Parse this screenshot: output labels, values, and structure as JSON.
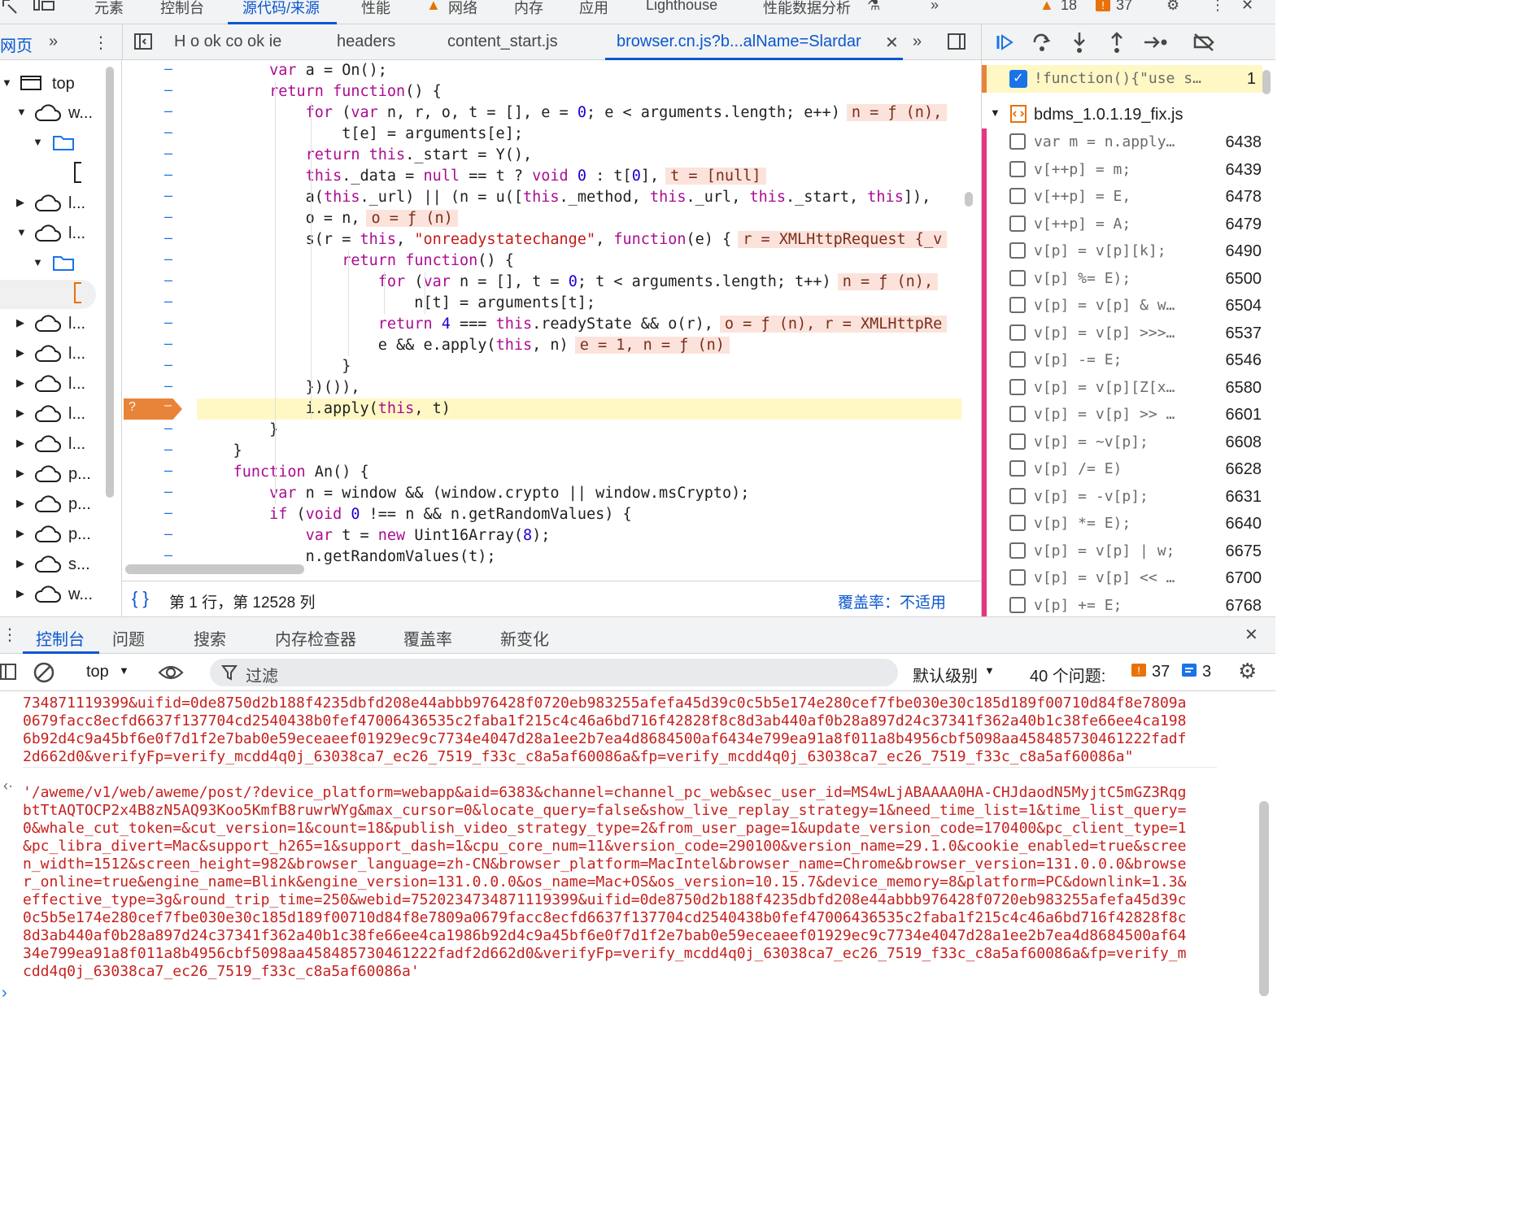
{
  "top_tabs": [
    "元素",
    "控制台",
    "源代码/来源",
    "性能",
    "网络",
    "内存",
    "应用",
    "Lighthouse",
    "性能数据分析"
  ],
  "top_counts": {
    "warnings": "18",
    "errors": "37"
  },
  "sub_tabs": {
    "page": "网页",
    "files": [
      "H o ok co ok ie",
      "headers",
      "content_start.js",
      "browser.cn.js?b...alName=Slardar"
    ]
  },
  "nav_tree": [
    "top",
    "w...",
    "l...",
    "l...",
    "l...",
    "l...",
    "l...",
    "l...",
    "l...",
    "p...",
    "p...",
    "p...",
    "s...",
    "w..."
  ],
  "code_lines": [
    [
      {
        "t": "        "
      },
      {
        "t": "var",
        "c": "kw"
      },
      {
        "t": " a = On();"
      }
    ],
    [
      {
        "t": "        "
      },
      {
        "t": "return",
        "c": "kw"
      },
      {
        "t": " "
      },
      {
        "t": "function",
        "c": "kw"
      },
      {
        "t": "() {"
      }
    ],
    [
      {
        "t": "            "
      },
      {
        "t": "for",
        "c": "kw"
      },
      {
        "t": " ("
      },
      {
        "t": "var",
        "c": "kw"
      },
      {
        "t": " n, r, o, t = [], e = "
      },
      {
        "t": "0",
        "c": "num"
      },
      {
        "t": "; e < arguments.length; e++)"
      },
      {
        "t": "n = ƒ (n),",
        "c": "inl"
      }
    ],
    [
      {
        "t": "                t[e] = arguments[e];"
      }
    ],
    [
      {
        "t": "            "
      },
      {
        "t": "return",
        "c": "kw"
      },
      {
        "t": " "
      },
      {
        "t": "this",
        "c": "kw"
      },
      {
        "t": "._start = Y(),"
      }
    ],
    [
      {
        "t": "            "
      },
      {
        "t": "this",
        "c": "kw"
      },
      {
        "t": "._data = "
      },
      {
        "t": "null",
        "c": "kw"
      },
      {
        "t": " == t ? "
      },
      {
        "t": "void",
        "c": "kw"
      },
      {
        "t": " "
      },
      {
        "t": "0",
        "c": "num"
      },
      {
        "t": " : t["
      },
      {
        "t": "0",
        "c": "num"
      },
      {
        "t": "],"
      },
      {
        "t": "t = [null]",
        "c": "inl"
      }
    ],
    [
      {
        "t": "            a("
      },
      {
        "t": "this",
        "c": "kw"
      },
      {
        "t": "._url) || (n = u(["
      },
      {
        "t": "this",
        "c": "kw"
      },
      {
        "t": "._method, "
      },
      {
        "t": "this",
        "c": "kw"
      },
      {
        "t": "._url, "
      },
      {
        "t": "this",
        "c": "kw"
      },
      {
        "t": "._start, "
      },
      {
        "t": "this",
        "c": "kw"
      },
      {
        "t": "]),"
      }
    ],
    [
      {
        "t": "            o = n,"
      },
      {
        "t": "o = ƒ (n)",
        "c": "inl"
      }
    ],
    [
      {
        "t": "            s(r = "
      },
      {
        "t": "this",
        "c": "kw"
      },
      {
        "t": ", "
      },
      {
        "t": "\"onreadystatechange\"",
        "c": "str"
      },
      {
        "t": ", "
      },
      {
        "t": "function",
        "c": "kw"
      },
      {
        "t": "(e) {"
      },
      {
        "t": "r = XMLHttpRequest {_v",
        "c": "inl"
      }
    ],
    [
      {
        "t": "                "
      },
      {
        "t": "return",
        "c": "kw"
      },
      {
        "t": " "
      },
      {
        "t": "function",
        "c": "kw"
      },
      {
        "t": "() {"
      }
    ],
    [
      {
        "t": "                    "
      },
      {
        "t": "for",
        "c": "kw"
      },
      {
        "t": " ("
      },
      {
        "t": "var",
        "c": "kw"
      },
      {
        "t": " n = [], t = "
      },
      {
        "t": "0",
        "c": "num"
      },
      {
        "t": "; t < arguments.length; t++)"
      },
      {
        "t": "n = ƒ (n),",
        "c": "inl"
      }
    ],
    [
      {
        "t": "                        n[t] = arguments[t];"
      }
    ],
    [
      {
        "t": "                    "
      },
      {
        "t": "return",
        "c": "kw"
      },
      {
        "t": " "
      },
      {
        "t": "4",
        "c": "num"
      },
      {
        "t": " === "
      },
      {
        "t": "this",
        "c": "kw"
      },
      {
        "t": ".readyState && o(r),"
      },
      {
        "t": "o = ƒ (n), r = XMLHttpRe",
        "c": "inl"
      }
    ],
    [
      {
        "t": "                    e && e.apply("
      },
      {
        "t": "this",
        "c": "kw"
      },
      {
        "t": ", n)"
      },
      {
        "t": "e = 1, n = ƒ (n)",
        "c": "inl"
      }
    ],
    [
      {
        "t": "                }"
      }
    ],
    [
      {
        "t": "            })()),"
      }
    ],
    [
      {
        "t": "            i.apply("
      },
      {
        "t": "this",
        "c": "kw"
      },
      {
        "t": ", t)"
      }
    ],
    [
      {
        "t": "        }"
      }
    ],
    [
      {
        "t": "    }"
      }
    ],
    [
      {
        "t": "    "
      },
      {
        "t": "function",
        "c": "kw"
      },
      {
        "t": " An() {"
      }
    ],
    [
      {
        "t": "        "
      },
      {
        "t": "var",
        "c": "kw"
      },
      {
        "t": " n = window && (window.crypto || window.msCrypto);"
      }
    ],
    [
      {
        "t": "        "
      },
      {
        "t": "if",
        "c": "kw"
      },
      {
        "t": " ("
      },
      {
        "t": "void",
        "c": "kw"
      },
      {
        "t": " "
      },
      {
        "t": "0",
        "c": "num"
      },
      {
        "t": " !== n && n.getRandomValues) {"
      }
    ],
    [
      {
        "t": "            "
      },
      {
        "t": "var",
        "c": "kw"
      },
      {
        "t": " t = "
      },
      {
        "t": "new",
        "c": "kw"
      },
      {
        "t": " Uint16Array("
      },
      {
        "t": "8",
        "c": "num"
      },
      {
        "t": ");"
      }
    ],
    [
      {
        "t": "            n.getRandomValues(t);"
      }
    ]
  ],
  "paused_marker": "?",
  "status": {
    "position": "第 1 行，第 12528 列",
    "coverage": "覆盖率：不适用"
  },
  "breakpoints": {
    "active": {
      "code": "!function(){\"use s…",
      "line": "1"
    },
    "file": "bdms_1.0.1.19_fix.js",
    "items": [
      {
        "code": "var m = n.apply…",
        "line": "6438"
      },
      {
        "code": "v[++p] = m;",
        "line": "6439"
      },
      {
        "code": "v[++p] = E,",
        "line": "6478"
      },
      {
        "code": "v[++p] = A;",
        "line": "6479"
      },
      {
        "code": "v[p] = v[p][k];",
        "line": "6490"
      },
      {
        "code": "v[p] %= E);",
        "line": "6500"
      },
      {
        "code": "v[p] = v[p] & w…",
        "line": "6504"
      },
      {
        "code": "v[p] = v[p] >>>…",
        "line": "6537"
      },
      {
        "code": "v[p] -= E;",
        "line": "6546"
      },
      {
        "code": "v[p] = v[p][Z[x…",
        "line": "6580"
      },
      {
        "code": "v[p] = v[p] >> …",
        "line": "6601"
      },
      {
        "code": "v[p] = ~v[p];",
        "line": "6608"
      },
      {
        "code": "v[p] /= E)",
        "line": "6628"
      },
      {
        "code": "v[p] = -v[p];",
        "line": "6631"
      },
      {
        "code": "v[p] *= E);",
        "line": "6640"
      },
      {
        "code": "v[p] = v[p] | w;",
        "line": "6675"
      },
      {
        "code": "v[p] = v[p] << …",
        "line": "6700"
      },
      {
        "code": "v[p] += E;",
        "line": "6768"
      }
    ]
  },
  "drawer_tabs": [
    "控制台",
    "问题",
    "搜索",
    "内存检查器",
    "覆盖率",
    "新变化"
  ],
  "console_toolbar": {
    "context": "top",
    "filter_placeholder": "过滤",
    "level": "默认级别",
    "issues_label": "40 个问题:",
    "issues_errors": "37",
    "issues_info": "3"
  },
  "console_lines": [
    "734871119399&uifid=0de8750d2b188f4235dbfd208e44abbb976428f0720eb983255afefa45d39c0c5b5e174e280cef7fbe030e30c185d189f00710d84f8e7809a",
    "0679facc8ecfd6637f137704cd2540438b0fef47006436535c2faba1f215c4c46a6bd716f42828f8c8d3ab440af0b28a897d24c37341f362a40b1c38fe66ee4ca198",
    "6b92d4c9a45bf6e0f7d1f2e7bab0e59eceaeef01929ec9c7734e4047d28a1ee2b7ea4d8684500af6434e799ea91a8f011a8b4956cbf5098aa458485730461222fadf",
    "2d662d0&verifyFp=verify_mcdd4q0j_63038ca7_ec26_7519_f33c_c8a5af60086a&fp=verify_mcdd4q0j_63038ca7_ec26_7519_f33c_c8a5af60086a\"",
    "'/aweme/v1/web/aweme/post/?device_platform=webapp&aid=6383&channel=channel_pc_web&sec_user_id=MS4wLjABAAAA0HA-CHJdaodN5MyjtC5mGZ3Rqg",
    "btTtAQTOCP2x4B8zN5AQ93Koo5KmfB8ruwrWYg&max_cursor=0&locate_query=false&show_live_replay_strategy=1&need_time_list=1&time_list_query=",
    "0&whale_cut_token=&cut_version=1&count=18&publish_video_strategy_type=2&from_user_page=1&update_version_code=170400&pc_client_type=1",
    "&pc_libra_divert=Mac&support_h265=1&support_dash=1&cpu_core_num=11&version_code=290100&version_name=29.1.0&cookie_enabled=true&scree",
    "n_width=1512&screen_height=982&browser_language=zh-CN&browser_platform=MacIntel&browser_name=Chrome&browser_version=131.0.0.0&browse",
    "r_online=true&engine_name=Blink&engine_version=131.0.0.0&os_name=Mac+OS&os_version=10.15.7&device_memory=8&platform=PC&downlink=1.3&",
    "effective_type=3g&round_trip_time=250&webid=7520234734871119399&uifid=0de8750d2b188f4235dbfd208e44abbb976428f0720eb983255afefa45d39c",
    "0c5b5e174e280cef7fbe030e30c185d189f00710d84f8e7809a0679facc8ecfd6637f137704cd2540438b0fef47006436535c2faba1f215c4c46a6bd716f42828f8c",
    "8d3ab440af0b28a897d24c37341f362a40b1c38fe66ee4ca1986b92d4c9a45bf6e0f7d1f2e7bab0e59eceaeef01929ec9c7734e4047d28a1ee2b7ea4d8684500af64",
    "34e799ea91a8f011a8b4956cbf5098aa458485730461222fadf2d662d0&verifyFp=verify_mcdd4q0j_63038ca7_ec26_7519_f33c_c8a5af60086a&fp=verify_m",
    "cdd4q0j_63038ca7_ec26_7519_f33c_c8a5af60086a'"
  ],
  "colors": {
    "accent": "#0b57d0",
    "breakpoint": "#e8833a",
    "error": "#c5221f",
    "highlight": "#fff8c5"
  }
}
